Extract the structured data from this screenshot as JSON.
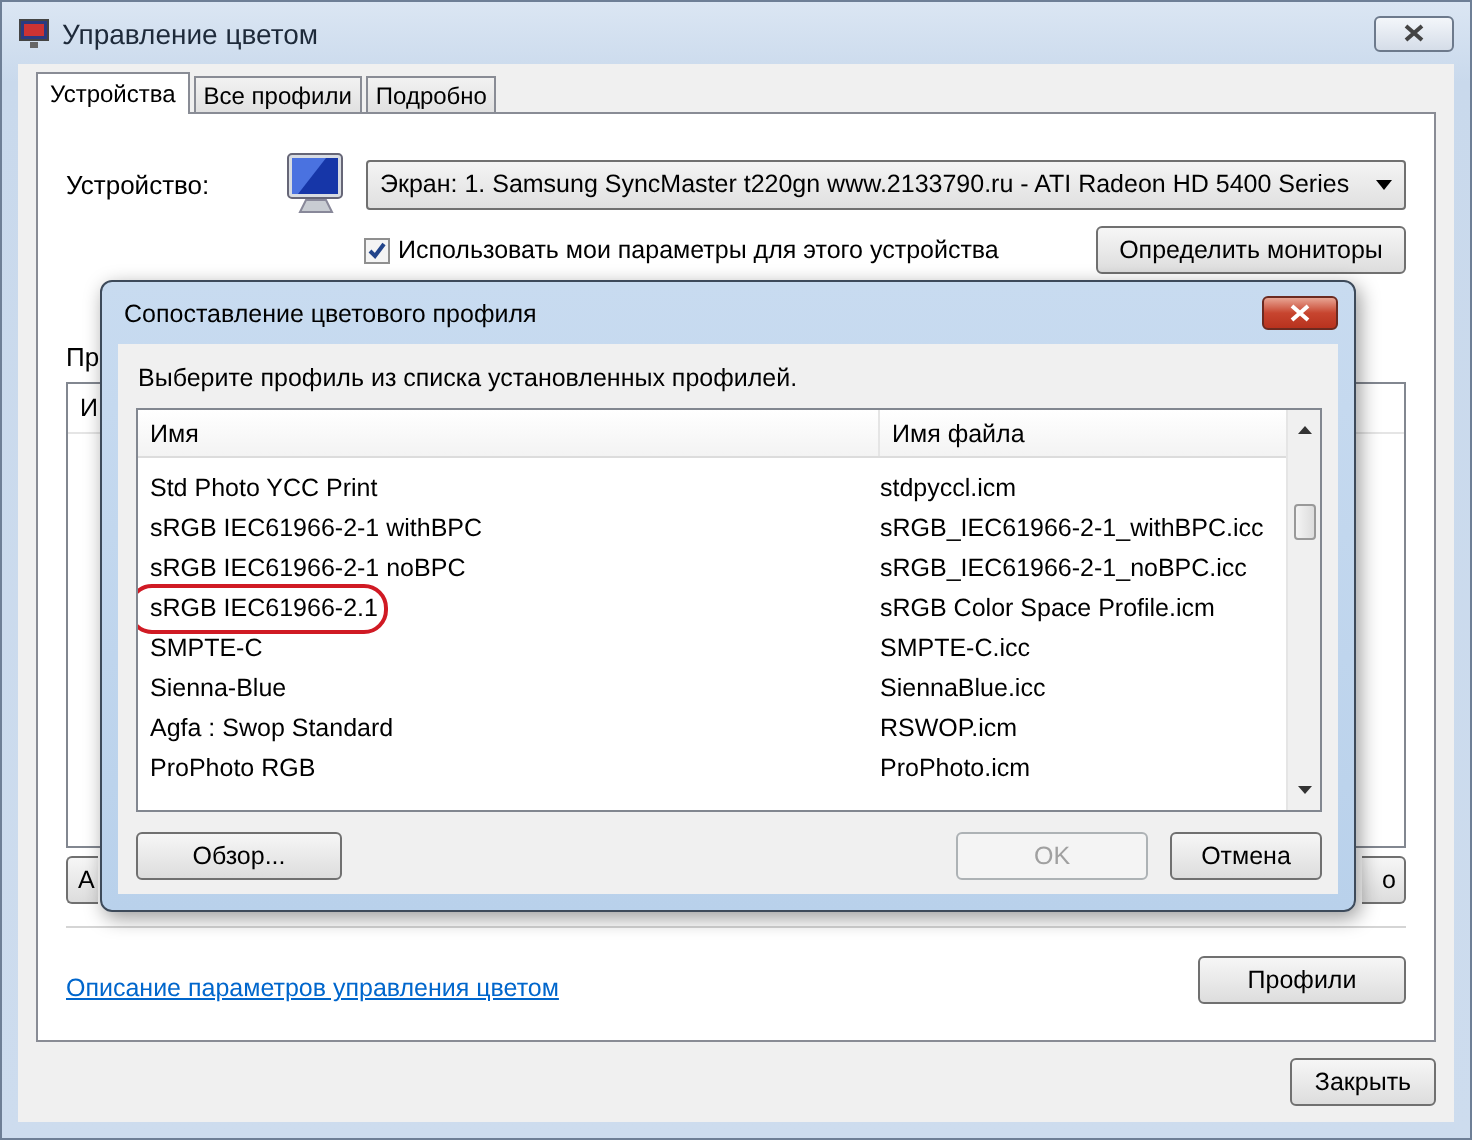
{
  "window": {
    "title": "Управление цветом"
  },
  "tabs": [
    {
      "label": "Устройства",
      "selected": true
    },
    {
      "label": "Все профили",
      "selected": false
    },
    {
      "label": "Подробно",
      "selected": false
    }
  ],
  "device": {
    "label": "Устройство:",
    "value": "Экран: 1. Samsung SyncMaster t220gn www.2133790.ru - ATI Radeon HD 5400 Series",
    "use_my_settings": {
      "label": "Использовать мои параметры для этого устройства",
      "checked": true
    },
    "identify_button": "Определить мониторы"
  },
  "behind": {
    "section_label": "Пр",
    "column_1": "И",
    "left_button": "А",
    "right_button": "о"
  },
  "link": "Описание параметров управления цветом",
  "profiles_button": "Профили",
  "close_button": "Закрыть",
  "dialog": {
    "title": "Сопоставление цветового профиля",
    "instruction": "Выберите профиль из списка установленных профилей.",
    "columns": [
      "Имя",
      "Имя файла"
    ],
    "rows": [
      {
        "name": "Std Photo YCC Print",
        "file": "stdpyccl.icm",
        "circled": false
      },
      {
        "name": "sRGB IEC61966-2-1 withBPC",
        "file": "sRGB_IEC61966-2-1_withBPC.icc",
        "circled": false
      },
      {
        "name": "sRGB IEC61966-2-1 noBPC",
        "file": "sRGB_IEC61966-2-1_noBPC.icc",
        "circled": false
      },
      {
        "name": "sRGB IEC61966-2.1",
        "file": "sRGB Color Space Profile.icm",
        "circled": true
      },
      {
        "name": "SMPTE-C",
        "file": "SMPTE-C.icc",
        "circled": false
      },
      {
        "name": "Sienna-Blue",
        "file": "SiennaBlue.icc",
        "circled": false
      },
      {
        "name": "Agfa : Swop Standard",
        "file": "RSWOP.icm",
        "circled": false
      },
      {
        "name": "ProPhoto RGB",
        "file": "ProPhoto.icm",
        "circled": false
      }
    ],
    "browse_button": "Обзор...",
    "ok_button": {
      "label": "OK",
      "disabled": true
    },
    "cancel_button": "Отмена"
  }
}
